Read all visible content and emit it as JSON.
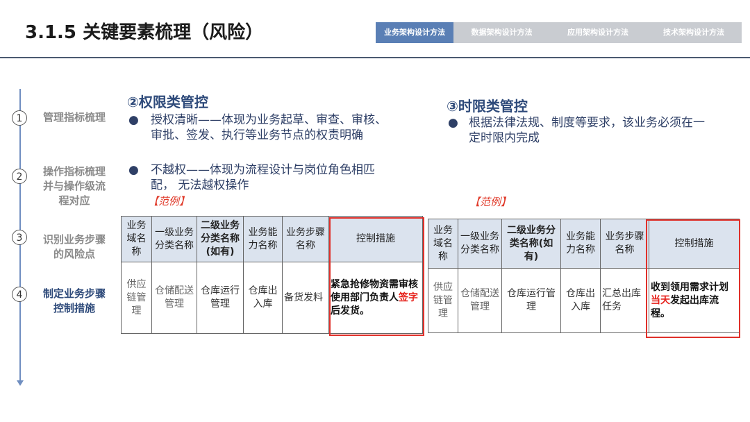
{
  "page_title": "3.1.5 关键要素梳理（风险）",
  "tabs": [
    "业务架构设计方法",
    "数据架构设计方法",
    "应用架构设计方法",
    "技术架构设计方法"
  ],
  "steps": [
    {
      "num": "1",
      "label": "管理指标梳理"
    },
    {
      "num": "2",
      "label": "操作指标梳理并与操作级流程对应"
    },
    {
      "num": "3",
      "label": "识别业务步骤的风险点"
    },
    {
      "num": "4",
      "label": "制定业务步骤控制措施"
    }
  ],
  "section2": {
    "title": "②权限类管控",
    "bullet1": "授权清晰——体现为业务起草、审查、审核、审批、签发、执行等业务节点的权责明确",
    "bullet2": "不越权——体现为流程设计与岗位角色相匹配， 无法越权操作",
    "example": "【范例】"
  },
  "section3": {
    "title": "③时限类管控",
    "bullet1": "根据法律法规、制度等要求，该业务必须在一定时限内完成",
    "example": "【范例】"
  },
  "table_headers": {
    "domain": "业务域名称",
    "level1": "一级业务分类名称",
    "level2": "二级业务分类名称(如有)",
    "capability": "业务能力名称",
    "step": "业务步骤名称",
    "control": "控制措施"
  },
  "table1_row": {
    "domain": "供应链管理",
    "level1": "仓储配送管理",
    "level2": "仓库运行管理",
    "capability": "仓库出入库",
    "step": "备货发料",
    "control_pre": "紧急抢修物资需审核使用部门负责人",
    "control_red": "签字",
    "control_post": "后发货。"
  },
  "table2_row": {
    "domain": "供应链管理",
    "level1": "仓储配送管理",
    "level2": "仓库运行管理",
    "capability": "仓库出入库",
    "step": "汇总出库任务",
    "control_pre": "收到领用需求计划",
    "control_red": "当天",
    "control_post": "发起出库流程。"
  },
  "colors": {
    "accent": "#2e4a7a",
    "tab_active": "#5a7fb5",
    "tab_inactive": "#c9ccd1",
    "highlight": "#e0302a"
  }
}
